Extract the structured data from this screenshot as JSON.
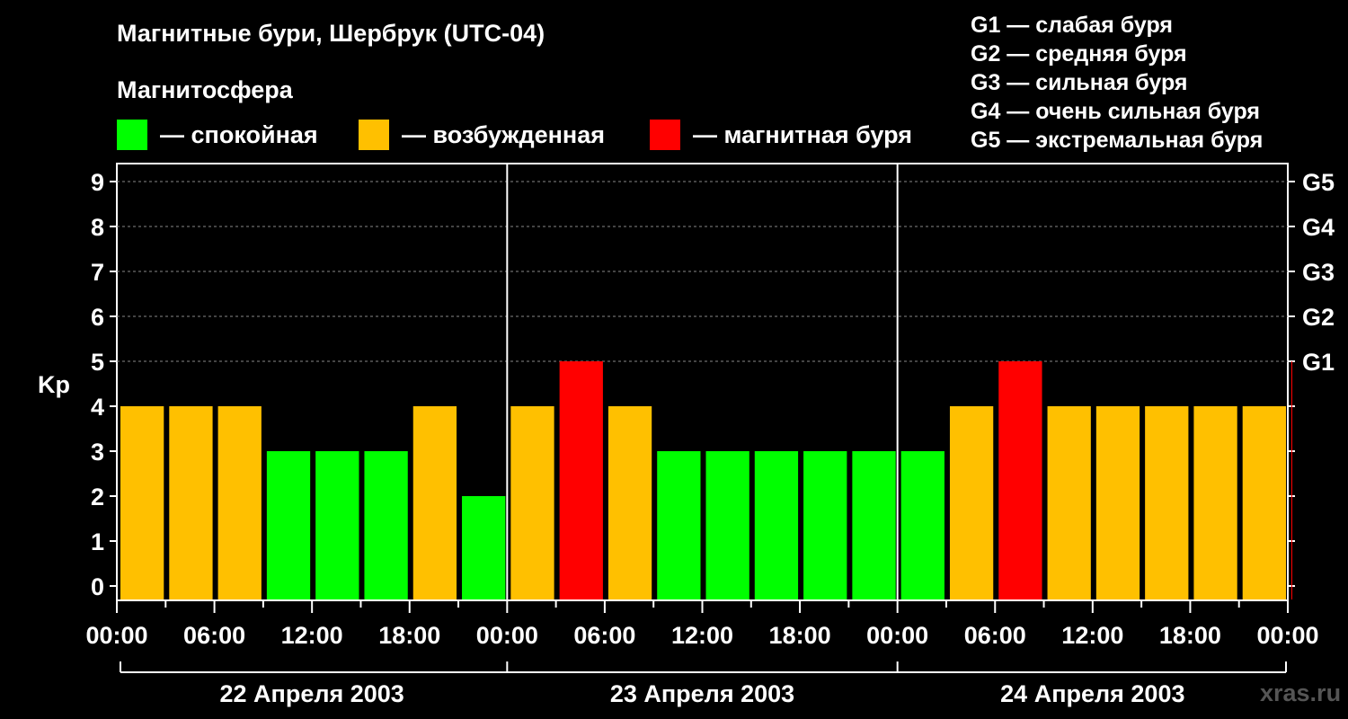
{
  "title": "Магнитные бури, Шербрук (UTC-04)",
  "legend": {
    "title": "Магнитосфера",
    "items": [
      {
        "label": "— спокойная",
        "color": "#00ff00"
      },
      {
        "label": "— возбужденная",
        "color": "#ffc000"
      },
      {
        "label": "— магнитная буря",
        "color": "#ff0000"
      }
    ]
  },
  "g_levels": [
    "G1 — слабая буря",
    "G2 — средняя буря",
    "G3 — сильная буря",
    "G4 — очень сильная буря",
    "G5 — экстремальная буря"
  ],
  "watermark": "xras.ru",
  "chart_data": {
    "type": "bar",
    "ylabel": "Kp",
    "ylim": [
      0,
      9
    ],
    "yticks": [
      "0",
      "1",
      "2",
      "3",
      "4",
      "5",
      "6",
      "7",
      "8",
      "9"
    ],
    "right_axis_labels": [
      {
        "kp": 5,
        "label": "G1"
      },
      {
        "kp": 6,
        "label": "G2"
      },
      {
        "kp": 7,
        "label": "G3"
      },
      {
        "kp": 8,
        "label": "G4"
      },
      {
        "kp": 9,
        "label": "G5"
      }
    ],
    "xticks": [
      "00:00",
      "06:00",
      "12:00",
      "18:00",
      "00:00",
      "06:00",
      "12:00",
      "18:00",
      "00:00",
      "06:00",
      "12:00",
      "18:00",
      "00:00"
    ],
    "days": [
      "22 Апреля 2003",
      "23 Апреля 2003",
      "24 Апреля 2003"
    ],
    "interval_hours": 3,
    "color_thresholds": {
      "quiet_max": 3,
      "active": 4,
      "storm_min": 5
    },
    "colors": {
      "quiet": "#00ff00",
      "active": "#ffc000",
      "storm": "#ff0000"
    },
    "values": [
      4,
      4,
      4,
      3,
      3,
      3,
      4,
      2,
      4,
      5,
      4,
      3,
      3,
      3,
      3,
      3,
      3,
      4,
      5,
      4,
      4,
      4,
      4,
      4,
      5
    ],
    "grid": true
  }
}
